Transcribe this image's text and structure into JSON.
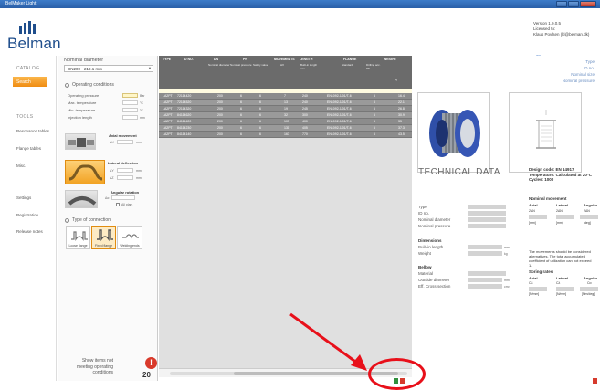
{
  "window": {
    "title": "BelMaker Light"
  },
  "header": {
    "logo_text": "Belman",
    "version": "Version 1.0.0.5",
    "licensed_label": "Licensed to:",
    "licensed_to": "Klaus Povlsen (kl@belman.dk)"
  },
  "sidebar": {
    "catalog": "CATALOG",
    "search": "Search",
    "tools": "TOOLS",
    "tools_items": [
      "Resonance tables",
      "Flange tables",
      "Misc."
    ],
    "footer_items": [
      "Settings",
      "Registration",
      "Release notes"
    ]
  },
  "panel": {
    "nd_label": "Nominal diameter",
    "nd_value": "DN200 - 219.1 mm",
    "op_title": "Operating conditions",
    "op_rows": [
      {
        "label": "Operating pressure",
        "unit": "Bar"
      },
      {
        "label": "Max. temperature",
        "unit": "°C"
      },
      {
        "label": "Min. temperature",
        "unit": "°C"
      },
      {
        "label": "Injection length",
        "unit": "mm"
      }
    ],
    "axial": {
      "title": "Axial movement",
      "sub": "ΔX",
      "unit": "mm"
    },
    "lateral": {
      "title": "Lateral deflection",
      "sub1": "ΔY",
      "sub2": "ΔZ",
      "unit": "mm"
    },
    "angular": {
      "title": "Angular rotation",
      "sub": "Δα",
      "check": "All plan."
    },
    "conn_title": "Type of connection",
    "connections": [
      "Loose flange",
      "Fixed flange",
      "Welding ends"
    ],
    "show_text": "Show items not meeting operating conditions",
    "count": "20",
    "warn_glyph": "!"
  },
  "grid": {
    "headers": [
      "TYPE",
      "ID NO.",
      "DN",
      "PN",
      "MOVEMENTS",
      "LENGTH",
      "FLANGE",
      "WEIGHT"
    ],
    "subheaders": [
      "Nominal diameter",
      "Nominal pressure",
      "Safety value",
      "ΔX",
      "Built-in length mm",
      "Standard",
      "Drilling acc. PN",
      "kg"
    ],
    "rows": [
      [
        "LA2PT",
        "72114420",
        "200",
        "6",
        "6",
        "7",
        "240",
        "EN1092-1/01/T-6",
        "6",
        "16.4"
      ],
      [
        "LA2PT",
        "72114520",
        "200",
        "6",
        "6",
        "13",
        "240",
        "EN1092-1/01/T-6",
        "6",
        "22.1"
      ],
      [
        "LA2PT",
        "72114320",
        "200",
        "6",
        "6",
        "19",
        "245",
        "EN1092-1/01/T-6",
        "6",
        "26.8"
      ],
      [
        "LA2PT",
        "84114620",
        "200",
        "6",
        "6",
        "32",
        "300",
        "EN1092-1/01/T-6",
        "6",
        "30.9"
      ],
      [
        "LA2PT",
        "84114420",
        "200",
        "6",
        "6",
        "103",
        "400",
        "EN1092-1/01/T-6",
        "6",
        "35"
      ],
      [
        "LA2PT",
        "84114230",
        "200",
        "6",
        "6",
        "131",
        "405",
        "EN1092-1/01/T-6",
        "6",
        "37.3"
      ],
      [
        "LA2PT",
        "84114140",
        "200",
        "6",
        "6",
        "163",
        "770",
        "EN1092-1/01/T-6",
        "6",
        "43.5"
      ]
    ]
  },
  "details": {
    "type_tags": [
      "Type",
      "ID no.",
      "Nominal size",
      "Nominal pressure"
    ],
    "tech_title": "TECHNICAL DATA",
    "design": [
      "Design code: EN 14917",
      "Temperature: Calculated at 20°C",
      "Cycles: 1000"
    ],
    "basic": [
      "Type",
      "ID no.",
      "Nominal diameter",
      "Nominal pressure"
    ],
    "dimensions": {
      "title": "Dimensions",
      "rows": [
        {
          "label": "Built-in length",
          "unit": "mm"
        },
        {
          "label": "Weight",
          "unit": "kg"
        }
      ]
    },
    "bellow": {
      "title": "Bellow",
      "rows": [
        {
          "label": "Material",
          "unit": ""
        },
        {
          "label": "Outside diameter",
          "unit": "mm"
        },
        {
          "label": "Eff. Cross-section",
          "unit": "cm²"
        }
      ]
    },
    "nominal_movement": {
      "title": "Nominal movement",
      "cols": [
        "Axial",
        "Lateral",
        "Angular"
      ],
      "values": [
        "2ΔN",
        "2ΔN",
        "2ΔN"
      ],
      "units": [
        "[mm]",
        "[mm]",
        "[deg]"
      ]
    },
    "note": "The movements should be considered alternatives. The total accumulated coefficient of utilization can not exceed 1.",
    "spring": {
      "title": "Spring rates",
      "cols": [
        "Axial",
        "Lateral",
        "Angular"
      ],
      "values": [
        "Cδ",
        "Cλ",
        "Cα"
      ],
      "units": [
        "[N/mm]",
        "[N/mm]",
        "[Nm/deg]"
      ]
    }
  },
  "colors": {
    "accent": "#f08c12",
    "brand": "#1f4e8c",
    "highlight_red": "#e8101a"
  }
}
